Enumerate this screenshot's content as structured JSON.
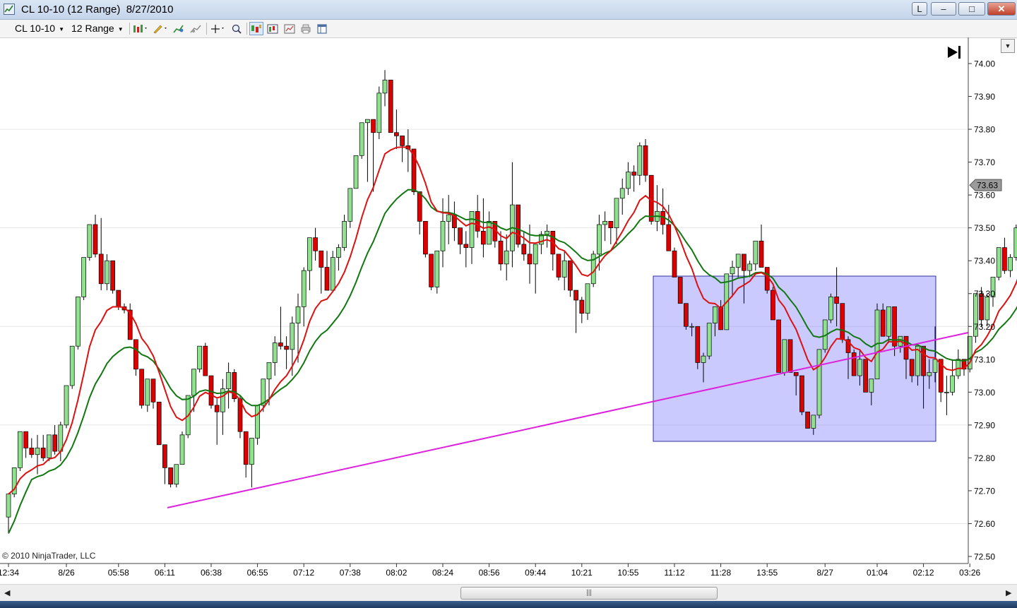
{
  "window": {
    "title": "CL 10-10 (12 Range)  8/27/2010",
    "btn_l": "L",
    "btn_min": "–",
    "btn_max": "□",
    "btn_close": "✕"
  },
  "toolbar": {
    "instrument": "CL 10-10",
    "period": "12 Range",
    "icons": [
      "bar-type-icon",
      "drawing-tools-icon",
      "indicator-icon",
      "strategy-icon",
      "crosshair-icon",
      "zoom-icon",
      "chart-trader-icon",
      "data-box-icon",
      "properties-icon",
      "print-icon",
      "template-icon"
    ]
  },
  "copyright": "© 2010 NinjaTrader, LLC",
  "price_marker": "73.63",
  "colors": {
    "up": "#90e090",
    "down": "#dd0000",
    "ema_fast": "#dd1111",
    "ema_slow": "#117711",
    "trendline": "#dd22dd",
    "box_fill": "#8080ff",
    "box_stroke": "#3030a0"
  },
  "chart_data": {
    "type": "candlestick",
    "title": "",
    "xlabel": "",
    "ylabel": "",
    "ylim": [
      72.5,
      74.0
    ],
    "yticks": [
      72.5,
      72.6,
      72.7,
      72.8,
      72.9,
      73.0,
      73.1,
      73.2,
      73.3,
      73.4,
      73.5,
      73.6,
      73.7,
      73.8,
      73.9,
      74.0
    ],
    "grid": true,
    "xtick_labels": [
      {
        "bar": 0,
        "label": "12:34"
      },
      {
        "bar": 10,
        "label": "8/26"
      },
      {
        "bar": 19,
        "label": "05:58"
      },
      {
        "bar": 27,
        "label": "06:11"
      },
      {
        "bar": 35,
        "label": "06:38"
      },
      {
        "bar": 43,
        "label": "06:55"
      },
      {
        "bar": 51,
        "label": "07:12"
      },
      {
        "bar": 59,
        "label": "07:38"
      },
      {
        "bar": 67,
        "label": "08:02"
      },
      {
        "bar": 75,
        "label": "08:24"
      },
      {
        "bar": 83,
        "label": "08:56"
      },
      {
        "bar": 91,
        "label": "09:44"
      },
      {
        "bar": 99,
        "label": "10:21"
      },
      {
        "bar": 107,
        "label": "10:55"
      },
      {
        "bar": 115,
        "label": "11:12"
      },
      {
        "bar": 123,
        "label": "11:28"
      },
      {
        "bar": 131,
        "label": "13:55"
      },
      {
        "bar": 141,
        "label": "8/27"
      },
      {
        "bar": 150,
        "label": "01:04"
      },
      {
        "bar": 158,
        "label": "02:12"
      },
      {
        "bar": 166,
        "label": "03:26"
      }
    ],
    "candles": [
      [
        72.62,
        72.69,
        72.57,
        72.69
      ],
      [
        72.69,
        72.77,
        72.68,
        72.77
      ],
      [
        72.77,
        72.88,
        72.76,
        72.88
      ],
      [
        72.88,
        72.87,
        72.8,
        72.83
      ],
      [
        72.83,
        72.86,
        72.8,
        72.81
      ],
      [
        72.81,
        72.87,
        72.75,
        72.83
      ],
      [
        72.83,
        72.87,
        72.79,
        72.8
      ],
      [
        72.8,
        72.87,
        72.79,
        72.87
      ],
      [
        72.87,
        72.9,
        72.81,
        72.82
      ],
      [
        72.82,
        72.91,
        72.79,
        72.9
      ],
      [
        72.9,
        73.02,
        72.89,
        73.02
      ],
      [
        73.02,
        73.14,
        73.01,
        73.14
      ],
      [
        73.14,
        73.29,
        73.13,
        73.29
      ],
      [
        73.29,
        73.41,
        73.28,
        73.41
      ],
      [
        73.41,
        73.51,
        73.4,
        73.51
      ],
      [
        73.51,
        73.54,
        73.41,
        73.42
      ],
      [
        73.42,
        73.53,
        73.31,
        73.33
      ],
      [
        73.33,
        73.42,
        73.31,
        73.4
      ],
      [
        73.4,
        73.39,
        73.3,
        73.31
      ],
      [
        73.31,
        73.3,
        73.25,
        73.26
      ],
      [
        73.26,
        73.27,
        73.24,
        73.25
      ],
      [
        73.25,
        73.27,
        73.16,
        73.16
      ],
      [
        73.16,
        73.15,
        73.05,
        73.07
      ],
      [
        73.07,
        73.04,
        72.95,
        72.96
      ],
      [
        72.96,
        73.04,
        72.94,
        73.04
      ],
      [
        73.04,
        73.04,
        72.95,
        72.97
      ],
      [
        72.97,
        72.96,
        72.84,
        72.84
      ],
      [
        72.84,
        72.84,
        72.72,
        72.77
      ],
      [
        72.77,
        72.75,
        72.71,
        72.72
      ],
      [
        72.72,
        72.78,
        72.71,
        72.78
      ],
      [
        72.78,
        72.88,
        72.78,
        72.87
      ],
      [
        72.87,
        72.99,
        72.86,
        72.99
      ],
      [
        72.99,
        73.07,
        72.94,
        73.07
      ],
      [
        73.07,
        73.14,
        73.06,
        73.14
      ],
      [
        73.14,
        73.15,
        73.05,
        73.05
      ],
      [
        73.05,
        73.04,
        72.95,
        72.96
      ],
      [
        72.96,
        72.98,
        72.84,
        72.94
      ],
      [
        72.94,
        73.04,
        72.87,
        73.01
      ],
      [
        73.01,
        73.09,
        72.95,
        73.06
      ],
      [
        73.06,
        73.07,
        72.97,
        72.98
      ],
      [
        72.98,
        72.99,
        72.86,
        72.88
      ],
      [
        72.88,
        72.86,
        72.74,
        72.78
      ],
      [
        72.78,
        72.84,
        72.71,
        72.86
      ],
      [
        72.86,
        72.96,
        72.84,
        72.96
      ],
      [
        72.96,
        73.04,
        72.94,
        73.04
      ],
      [
        73.04,
        73.09,
        72.96,
        73.09
      ],
      [
        73.09,
        73.17,
        73.05,
        73.15
      ],
      [
        73.15,
        73.26,
        73.13,
        73.14
      ],
      [
        73.14,
        73.17,
        73.07,
        73.13
      ],
      [
        73.13,
        73.23,
        73.05,
        73.21
      ],
      [
        73.21,
        73.3,
        73.09,
        73.26
      ],
      [
        73.26,
        73.38,
        73.2,
        73.37
      ],
      [
        73.37,
        73.47,
        73.31,
        73.47
      ],
      [
        73.47,
        73.5,
        73.4,
        73.43
      ],
      [
        73.43,
        73.39,
        73.3,
        73.38
      ],
      [
        73.38,
        73.43,
        73.34,
        73.31
      ],
      [
        73.31,
        73.43,
        73.31,
        73.41
      ],
      [
        73.41,
        73.45,
        73.37,
        73.44
      ],
      [
        73.44,
        73.54,
        73.43,
        73.52
      ],
      [
        73.52,
        73.62,
        73.5,
        73.62
      ],
      [
        73.62,
        73.72,
        73.62,
        73.72
      ],
      [
        73.72,
        73.82,
        73.71,
        73.82
      ],
      [
        73.82,
        73.76,
        73.64,
        73.83
      ],
      [
        73.83,
        73.77,
        73.61,
        73.79
      ],
      [
        73.79,
        73.93,
        73.77,
        73.91
      ],
      [
        73.91,
        73.98,
        73.87,
        73.95
      ],
      [
        73.95,
        73.88,
        73.85,
        73.79
      ],
      [
        73.79,
        73.86,
        73.74,
        73.78
      ],
      [
        73.78,
        73.75,
        73.7,
        73.75
      ],
      [
        73.75,
        73.8,
        73.67,
        73.74
      ],
      [
        73.74,
        73.73,
        73.6,
        73.61
      ],
      [
        73.61,
        73.61,
        73.48,
        73.52
      ],
      [
        73.52,
        73.51,
        73.41,
        73.42
      ],
      [
        73.42,
        73.4,
        73.31,
        73.32
      ],
      [
        73.32,
        73.41,
        73.3,
        73.43
      ],
      [
        73.43,
        73.59,
        73.38,
        73.52
      ],
      [
        73.52,
        73.6,
        73.45,
        73.54
      ],
      [
        73.54,
        73.58,
        73.46,
        73.5
      ],
      [
        73.5,
        73.46,
        73.42,
        73.45
      ],
      [
        73.45,
        73.49,
        73.38,
        73.44
      ],
      [
        73.44,
        73.52,
        73.39,
        73.55
      ],
      [
        73.55,
        73.6,
        73.47,
        73.49
      ],
      [
        73.49,
        73.59,
        73.41,
        73.45
      ],
      [
        73.45,
        73.55,
        73.45,
        73.52
      ],
      [
        73.52,
        73.52,
        73.44,
        73.46
      ],
      [
        73.46,
        73.49,
        73.37,
        73.39
      ],
      [
        73.39,
        73.48,
        73.34,
        73.43
      ],
      [
        73.43,
        73.7,
        73.38,
        73.57
      ],
      [
        73.57,
        73.55,
        73.44,
        73.45
      ],
      [
        73.45,
        73.49,
        73.4,
        73.42
      ],
      [
        73.42,
        73.51,
        73.33,
        73.39
      ],
      [
        73.39,
        73.45,
        73.3,
        73.45
      ],
      [
        73.45,
        73.49,
        73.42,
        73.48
      ],
      [
        73.48,
        73.51,
        73.44,
        73.49
      ],
      [
        73.49,
        73.43,
        73.37,
        73.42
      ],
      [
        73.42,
        73.39,
        73.34,
        73.35
      ],
      [
        73.35,
        73.43,
        73.31,
        73.4
      ],
      [
        73.4,
        73.39,
        73.29,
        73.31
      ],
      [
        73.31,
        73.31,
        73.18,
        73.28
      ],
      [
        73.28,
        73.29,
        73.21,
        73.24
      ],
      [
        73.24,
        73.33,
        73.22,
        73.33
      ],
      [
        73.33,
        73.43,
        73.32,
        73.42
      ],
      [
        73.42,
        73.54,
        73.37,
        73.51
      ],
      [
        73.51,
        73.55,
        73.46,
        73.52
      ],
      [
        73.52,
        73.52,
        73.45,
        73.5
      ],
      [
        73.5,
        73.59,
        73.45,
        73.59
      ],
      [
        73.59,
        73.65,
        73.54,
        73.62
      ],
      [
        73.62,
        73.7,
        73.6,
        73.67
      ],
      [
        73.67,
        73.69,
        73.61,
        73.66
      ],
      [
        73.66,
        73.76,
        73.63,
        73.75
      ],
      [
        73.75,
        73.77,
        73.64,
        73.66
      ],
      [
        73.66,
        73.64,
        73.51,
        73.52
      ],
      [
        73.52,
        73.63,
        73.49,
        73.55
      ],
      [
        73.55,
        73.62,
        73.48,
        73.51
      ],
      [
        73.51,
        73.57,
        73.44,
        73.43
      ],
      [
        73.43,
        73.44,
        73.36,
        73.35
      ],
      [
        73.35,
        73.33,
        73.27,
        73.27
      ],
      [
        73.27,
        73.25,
        73.19,
        73.2
      ],
      [
        73.2,
        73.21,
        73.17,
        73.2
      ],
      [
        73.2,
        73.17,
        73.07,
        73.09
      ],
      [
        73.09,
        73.12,
        73.03,
        73.11
      ],
      [
        73.11,
        73.21,
        73.1,
        73.21
      ],
      [
        73.21,
        73.26,
        73.17,
        73.26
      ],
      [
        73.26,
        73.28,
        73.19,
        73.19
      ],
      [
        73.19,
        73.21,
        73.2,
        73.36
      ],
      [
        73.36,
        73.4,
        73.29,
        73.38
      ],
      [
        73.38,
        73.42,
        73.35,
        73.42
      ],
      [
        73.42,
        73.4,
        73.27,
        73.37
      ],
      [
        73.37,
        73.4,
        73.35,
        73.39
      ],
      [
        73.39,
        73.46,
        73.37,
        73.46
      ],
      [
        73.46,
        73.51,
        73.4,
        73.38
      ],
      [
        73.38,
        73.38,
        73.3,
        73.31
      ],
      [
        73.31,
        73.32,
        73.22,
        73.22
      ],
      [
        73.22,
        73.12,
        73.06,
        73.06
      ],
      [
        73.06,
        73.13,
        73.05,
        73.16
      ],
      [
        73.16,
        73.06,
        73.06,
        73.06
      ],
      [
        73.06,
        73.05,
        72.99,
        73.05
      ],
      [
        73.05,
        73.0,
        72.93,
        72.94
      ],
      [
        72.94,
        72.93,
        72.89,
        72.89
      ],
      [
        72.89,
        72.93,
        72.87,
        72.93
      ],
      [
        72.93,
        73.13,
        72.92,
        73.13
      ],
      [
        73.13,
        73.22,
        73.12,
        73.22
      ],
      [
        73.22,
        73.3,
        73.21,
        73.29
      ],
      [
        73.29,
        73.38,
        73.2,
        73.27
      ],
      [
        73.27,
        73.25,
        73.15,
        73.16
      ],
      [
        73.16,
        73.17,
        73.04,
        73.12
      ],
      [
        73.12,
        73.13,
        73.07,
        73.05
      ],
      [
        73.05,
        73.13,
        73.02,
        73.1
      ],
      [
        73.1,
        73.1,
        73.01,
        73.0
      ],
      [
        73.0,
        73.02,
        72.96,
        73.04
      ],
      [
        73.04,
        73.27,
        73.08,
        73.25
      ],
      [
        73.25,
        73.27,
        73.21,
        73.17
      ],
      [
        73.17,
        73.24,
        73.15,
        73.26
      ],
      [
        73.26,
        73.19,
        73.11,
        73.14
      ],
      [
        73.14,
        73.17,
        73.12,
        73.17
      ],
      [
        73.17,
        73.11,
        73.04,
        73.1
      ],
      [
        73.1,
        73.08,
        73.03,
        73.05
      ],
      [
        73.05,
        73.14,
        73.02,
        73.14
      ],
      [
        73.14,
        73.09,
        72.95,
        73.05
      ],
      [
        73.05,
        73.1,
        73.01,
        73.06
      ],
      [
        73.06,
        73.2,
        73.03,
        73.1
      ],
      [
        73.1,
        73.08,
        72.97,
        73.0
      ],
      [
        73.0,
        73.05,
        72.93,
        73.0
      ],
      [
        73.0,
        73.1,
        72.99,
        73.05
      ],
      [
        73.05,
        73.13,
        73.04,
        73.1
      ],
      [
        73.1,
        73.1,
        73.05,
        73.07
      ],
      [
        73.07,
        73.17,
        73.06,
        73.17
      ],
      [
        73.17,
        73.3,
        73.15,
        73.3
      ],
      [
        73.3,
        73.32,
        73.2,
        73.22
      ],
      [
        73.22,
        73.3,
        73.2,
        73.29
      ],
      [
        73.29,
        73.35,
        73.26,
        73.35
      ],
      [
        73.35,
        73.44,
        73.34,
        73.44
      ],
      [
        73.44,
        73.47,
        73.36,
        73.37
      ],
      [
        73.37,
        73.42,
        73.35,
        73.41
      ],
      [
        73.41,
        73.51,
        73.4,
        73.5
      ],
      [
        73.5,
        73.59,
        73.48,
        73.59
      ],
      [
        73.59,
        73.66,
        73.54,
        73.64
      ],
      [
        73.64,
        73.75,
        73.64,
        73.61
      ]
    ]
  }
}
